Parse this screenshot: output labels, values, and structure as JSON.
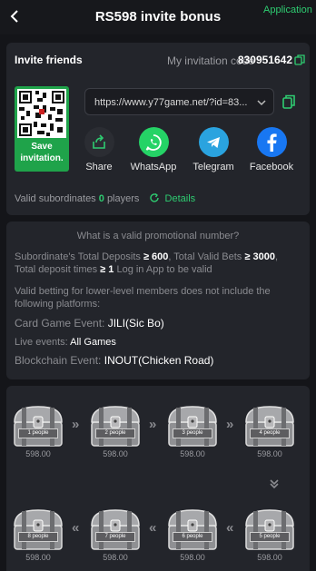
{
  "header": {
    "title": "RS598 invite bonus",
    "application_record": "Application Record"
  },
  "invite": {
    "title": "Invite friends",
    "code_label": "My invitation code",
    "code_value": "830951642",
    "save_label": "Save invitation.",
    "link": "https://www.y77game.net/?id=83...",
    "share": [
      {
        "name": "share",
        "label": "Share",
        "color": "#2b2d33"
      },
      {
        "name": "whatsapp",
        "label": "WhatsApp",
        "color": "#25d366"
      },
      {
        "name": "telegram",
        "label": "Telegram",
        "color": "#2aa3df"
      },
      {
        "name": "facebook",
        "label": "Facebook",
        "color": "#1877f2"
      }
    ],
    "valid_label": "Valid subordinates",
    "valid_count": "0",
    "valid_unit": "players",
    "details_label": "Details"
  },
  "faq": {
    "title": "What is a valid promotional number?",
    "req_prefix": "Subordinate's Total Deposits",
    "req_deposit": "≥ 600",
    "req_bets_label": ",  Total Valid Bets",
    "req_bets": "≥ 3000",
    "req_times_label": ",  Total deposit times",
    "req_times": "≥ 1",
    "req_suffix": "Log in App to be valid",
    "note": "Valid betting for lower-level members does not include the following platforms:",
    "card_label": "Card Game Event:",
    "card_value": "JILI(Sic Bo)",
    "live_label": "Live events:",
    "live_value": "All Games",
    "block_label": "Blockchain Event:",
    "block_value": "INOUT(Chicken Road)"
  },
  "chests": [
    {
      "label": "1 people",
      "amount": "598.00"
    },
    {
      "label": "2 people",
      "amount": "598.00"
    },
    {
      "label": "3 people",
      "amount": "598.00"
    },
    {
      "label": "4 people",
      "amount": "598.00"
    },
    {
      "label": "8 people",
      "amount": "598.00"
    },
    {
      "label": "7 people",
      "amount": "598.00"
    },
    {
      "label": "6 people",
      "amount": "598.00"
    },
    {
      "label": "5 people",
      "amount": "598.00"
    }
  ],
  "arrows": {
    "right": "»",
    "left": "«"
  },
  "colors": {
    "accent": "#2ecc71",
    "background": "#141519",
    "card": "#23252b"
  }
}
